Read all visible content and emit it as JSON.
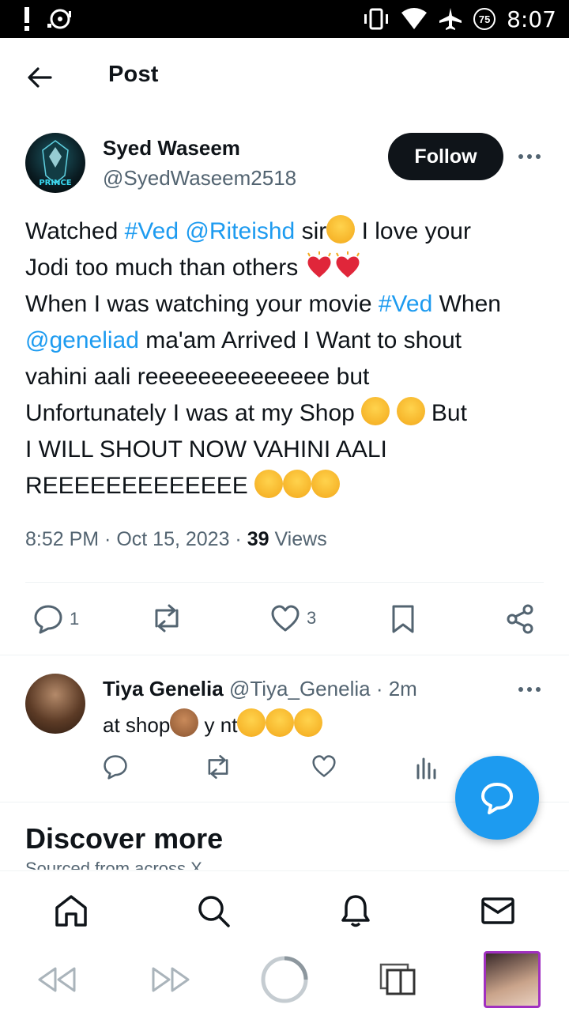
{
  "status_bar": {
    "time": "8:07",
    "battery": "75"
  },
  "header": {
    "title": "Post"
  },
  "author": {
    "name": "Syed Waseem",
    "handle": "@SyedWaseem2518",
    "avatar_text": "PRINCE",
    "follow_label": "Follow"
  },
  "tweet": {
    "line1_a": "Watched ",
    "tag_ved": "#Ved",
    "mention_riteish": "@Riteishd",
    "line1_b": " sir",
    "line1_c": "  I love your",
    "line2": "Jodi too much than others ",
    "line3_a": "When I was watching your movie ",
    "line3_tag": "#Ved",
    "line3_b": " When",
    "mention_genelia": "@geneliad",
    "line4": " ma'am Arrived I Want to shout",
    "line5": "vahini aali reeeeeeeeeeeeee but",
    "line6_a": "Unfortunately I was at my Shop ",
    "line6_b": " But",
    "line7": "I WILL SHOUT NOW VAHINI AALI",
    "line8": "REEEEEEEEEEEEE "
  },
  "meta": {
    "time": "8:52 PM",
    "sep1": " · ",
    "date": "Oct 15, 2023",
    "sep2": " · ",
    "views_count": "39",
    "views_label": " Views"
  },
  "actions": {
    "replies": "1",
    "reposts": "",
    "likes": "3"
  },
  "reply": {
    "name": "Tiya Genelia",
    "handle": "@Tiya_Genelia",
    "time": "2m",
    "dot": "·",
    "text_a": "at shop",
    "text_b": " y nt"
  },
  "discover": {
    "title": "Discover more",
    "subtitle": "Sourced from across X"
  },
  "icons": {
    "back": "arrow-left-icon",
    "more": "more-horizontal-icon",
    "reply": "comment-icon",
    "repost": "repost-icon",
    "like": "heart-icon",
    "bookmark": "bookmark-icon",
    "share": "share-icon",
    "analytics": "analytics-icon",
    "compose": "compose-reply-icon",
    "home": "home-icon",
    "search": "search-icon",
    "notifications": "bell-icon",
    "messages": "mail-icon"
  },
  "colors": {
    "accent": "#1d9bf0",
    "text": "#0f1419",
    "muted": "#536471",
    "follow_bg": "#0f1419"
  }
}
